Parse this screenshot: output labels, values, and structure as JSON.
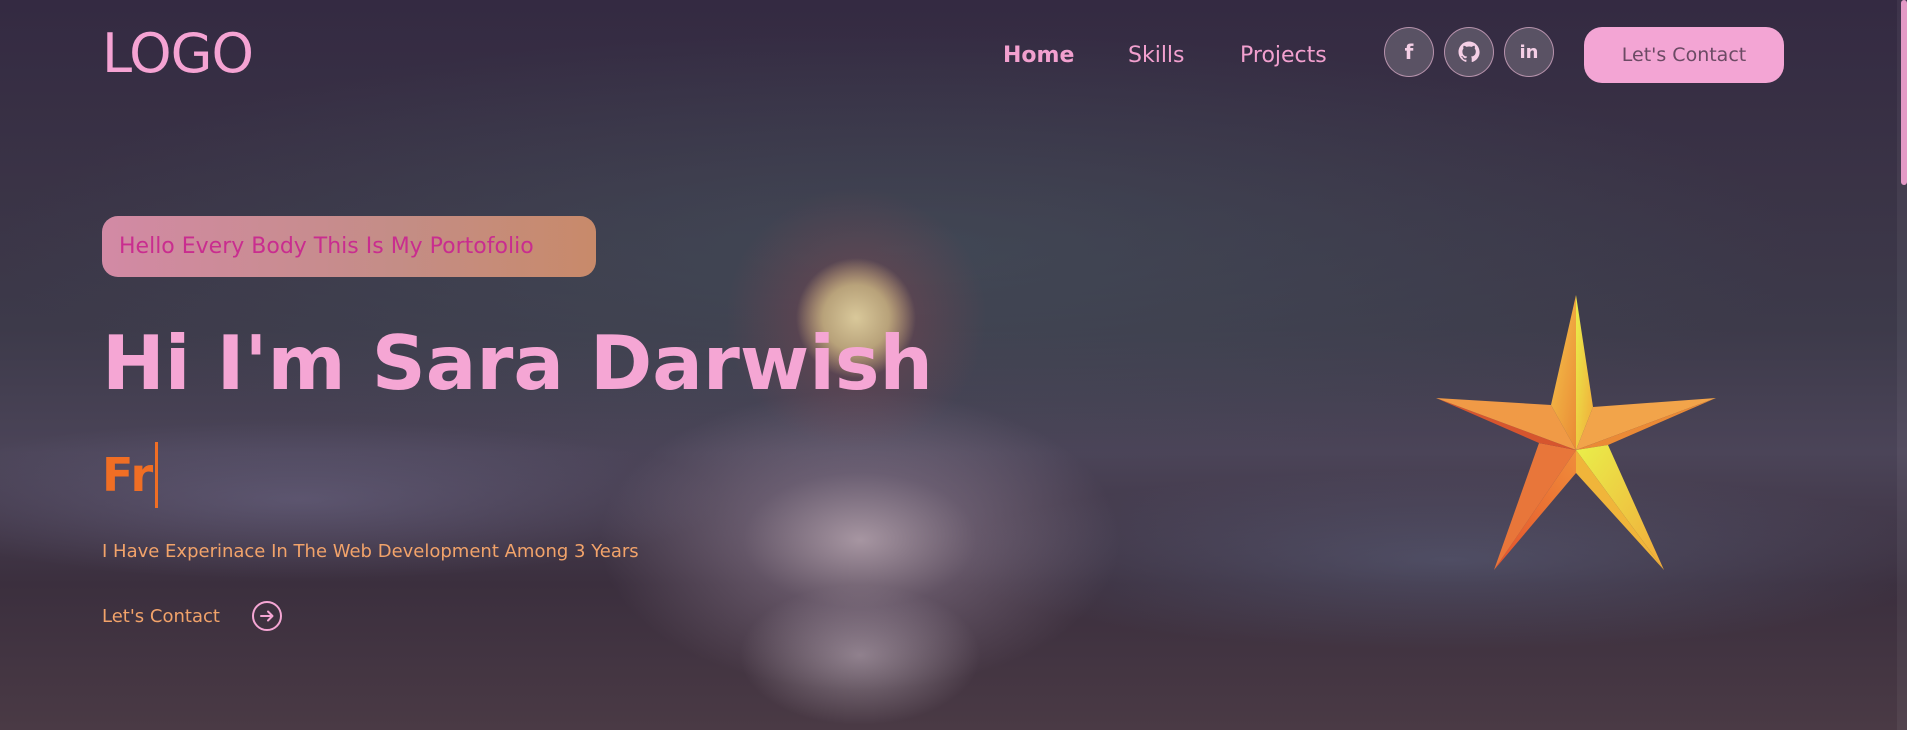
{
  "header": {
    "logo": "LOGO",
    "nav": [
      {
        "label": "Home",
        "active": true
      },
      {
        "label": "Skills",
        "active": false
      },
      {
        "label": "Projects",
        "active": false
      }
    ],
    "social": [
      {
        "icon": "facebook-icon",
        "glyph": "f"
      },
      {
        "icon": "github-icon"
      },
      {
        "icon": "linkedin-icon",
        "glyph": "in"
      }
    ],
    "cta_label": "Let's Contact"
  },
  "hero": {
    "tagline": "Hello Every Body This Is My Portofolio",
    "title": "Hi I'm Sara Darwish",
    "typed_text": "Fr",
    "description": "I Have Experinace In The Web Development Among 3 Years",
    "contact_label": "Let's Contact",
    "contact_icon": "arrow-right-circle-icon",
    "illustration": "star-icon"
  },
  "colors": {
    "accent_pink": "#f5a6d4",
    "accent_orange": "#f06e24",
    "text_peach": "#f2a36a",
    "tag_text": "#c92d8f"
  }
}
